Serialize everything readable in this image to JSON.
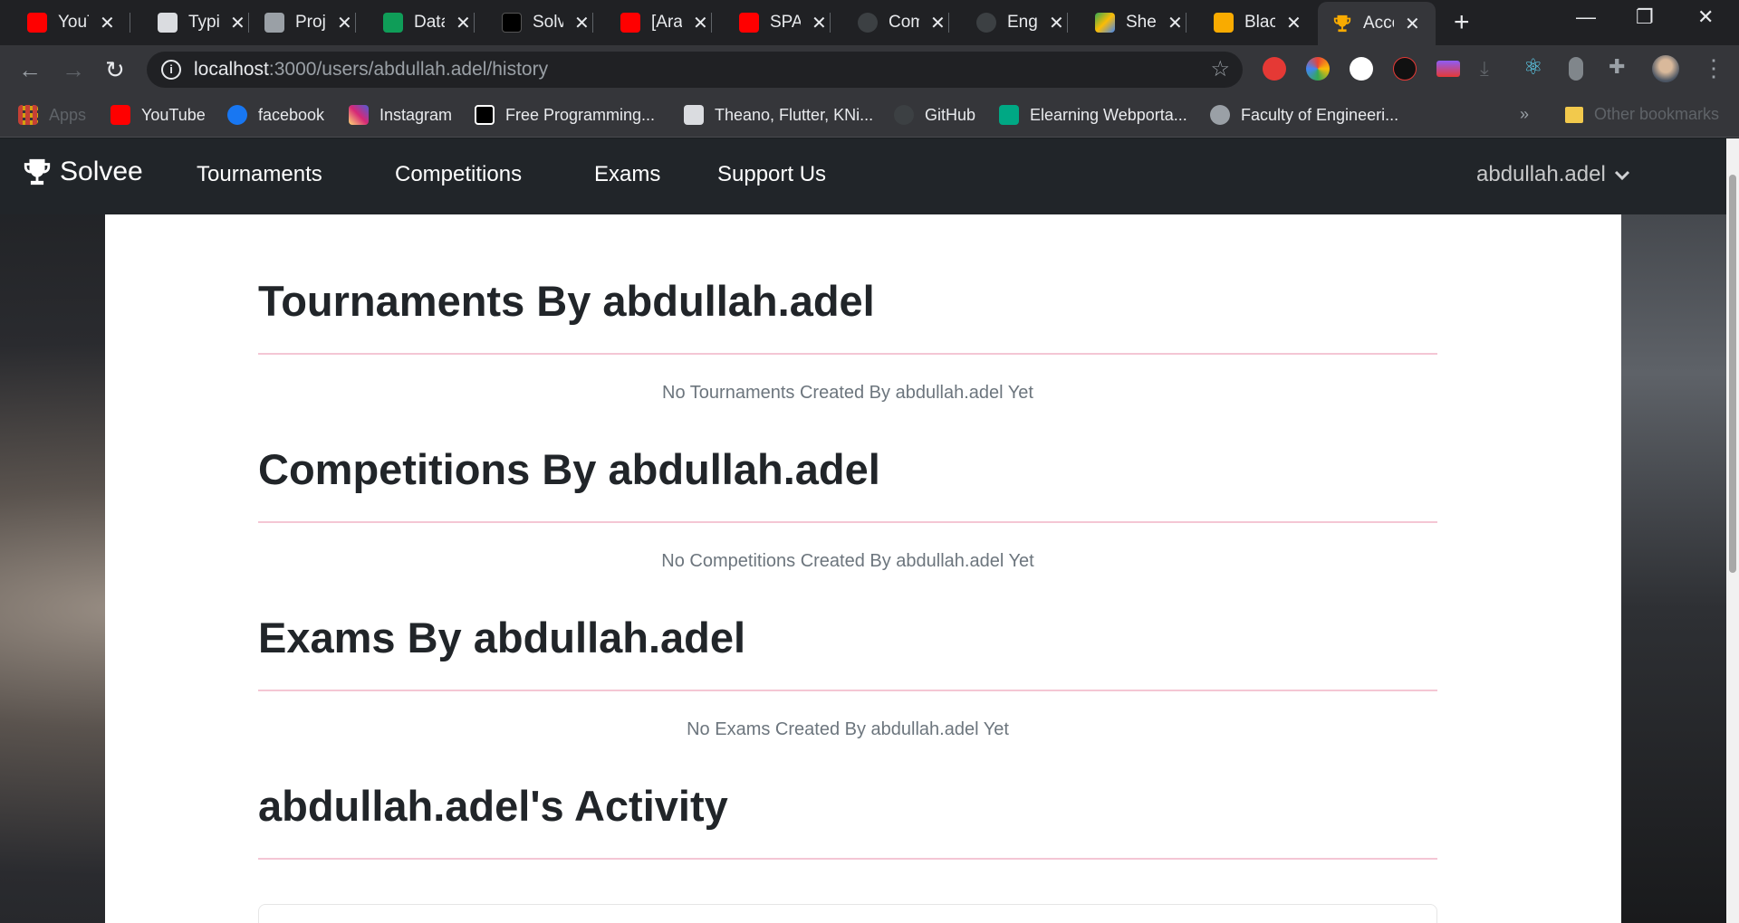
{
  "tabs": [
    {
      "title": "YouT",
      "fav_color": "#ff0000"
    },
    {
      "title": "Typi",
      "fav_color": "#dadce0"
    },
    {
      "title": "Proj",
      "fav_color": "#9aa0a6"
    },
    {
      "title": "Data",
      "fav_color": "#0f9d58"
    },
    {
      "title": "Solv",
      "fav_color": "#000000"
    },
    {
      "title": "[Ara",
      "fav_color": "#ff0000"
    },
    {
      "title": "SPA",
      "fav_color": "#ff0000"
    },
    {
      "title": "Com",
      "fav_color": "#3c4043"
    },
    {
      "title": "Engi",
      "fav_color": "#3c4043"
    },
    {
      "title": "Shee",
      "fav_color": "#34a853"
    },
    {
      "title": "Blac",
      "fav_color": "#f9ab00"
    },
    {
      "title": "Acco",
      "fav_color": "#f9ab00"
    }
  ],
  "tab_close": "✕",
  "new_tab": "+",
  "window": {
    "minimize": "—",
    "restore": "❐",
    "close": "✕"
  },
  "omnibox": {
    "host": "localhost",
    "path": ":3000/users/abdullah.adel/history"
  },
  "bookmarks": [
    {
      "label": "Apps",
      "color": "#ea4335",
      "muted": true
    },
    {
      "label": "YouTube",
      "color": "#ff0000"
    },
    {
      "label": "facebook",
      "color": "#1877f2"
    },
    {
      "label": "Instagram",
      "color": "#e1306c"
    },
    {
      "label": "Free Programming...",
      "color": "#000000"
    },
    {
      "label": "Theano, Flutter, KNi...",
      "color": "#dadce0"
    },
    {
      "label": "GitHub",
      "color": "#3c4043"
    },
    {
      "label": "Elearning Webporta...",
      "color": "#00a884"
    },
    {
      "label": "Faculty of Engineeri...",
      "color": "#9aa0a6"
    }
  ],
  "bookmarks_more": "»",
  "other_bookmarks": "Other bookmarks",
  "app": {
    "brand": "Solvee",
    "nav": [
      "Tournaments",
      "Competitions",
      "Exams",
      "Support Us"
    ],
    "user": "abdullah.adel"
  },
  "sections": [
    {
      "title": "Tournaments By abdullah.adel",
      "empty": "No Tournaments Created By abdullah.adel Yet"
    },
    {
      "title": "Competitions By abdullah.adel",
      "empty": "No Competitions Created By abdullah.adel Yet"
    },
    {
      "title": "Exams By abdullah.adel",
      "empty": "No Exams Created By abdullah.adel Yet"
    },
    {
      "title": "abdullah.adel's Activity",
      "empty": ""
    }
  ],
  "colors": {
    "accent_divider": "#f4c6d4",
    "navbar": "#212529"
  }
}
